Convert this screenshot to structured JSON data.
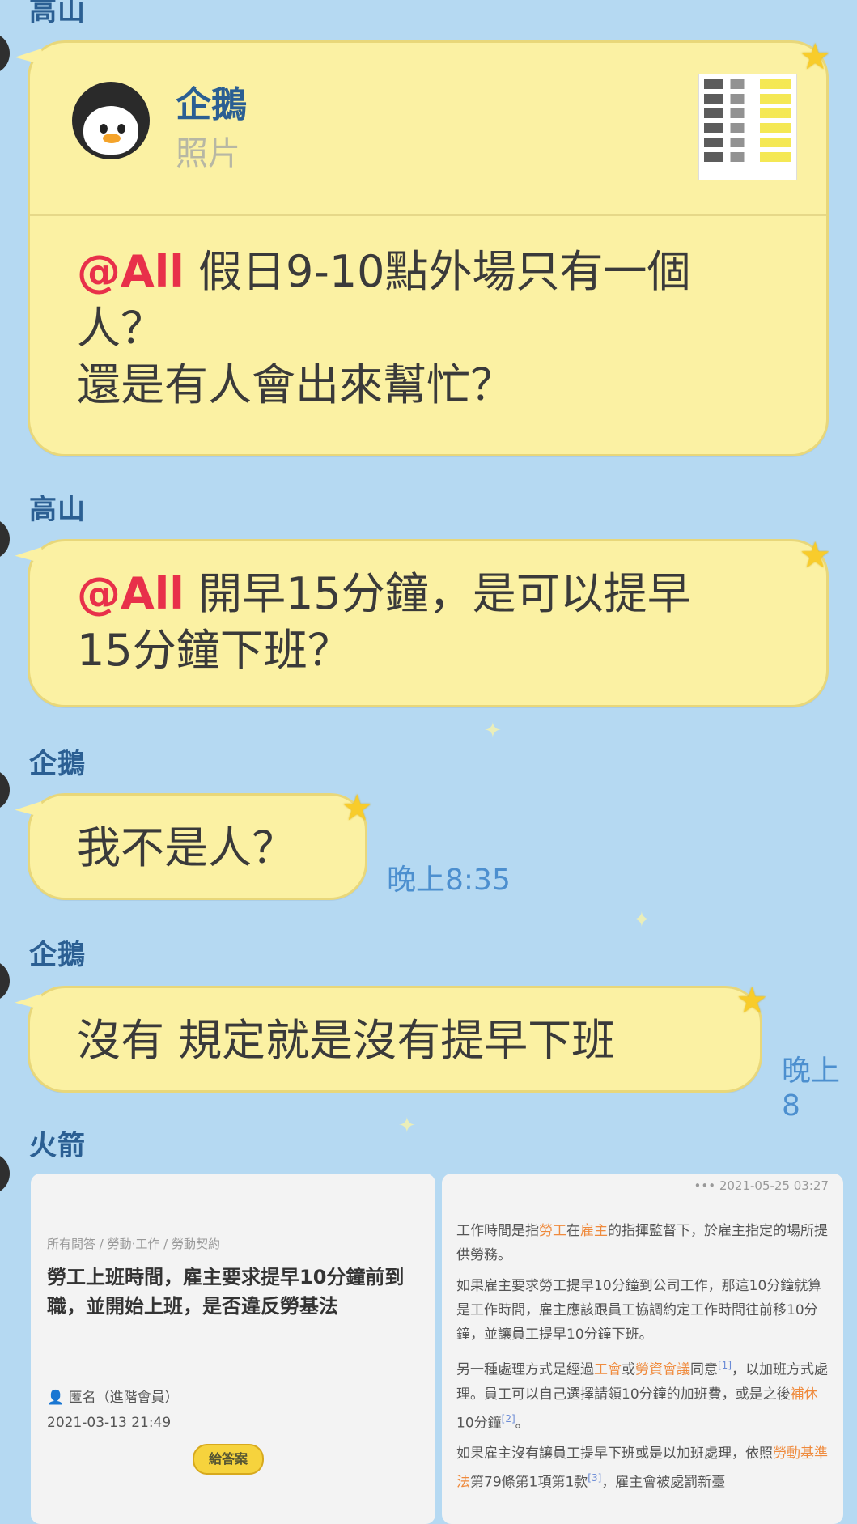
{
  "messages": [
    {
      "sender": "高山"
    },
    {
      "reply": {
        "name": "企鵝",
        "type": "照片"
      },
      "mention": "@All",
      "text_lines": [
        "假日9-10點外場只有一個",
        "人？",
        "還是有人會出來幫忙？"
      ]
    },
    {
      "sender": "高山",
      "mention": "@All",
      "text_lines": [
        "開早15分鐘，是可以提早",
        "15分鐘下班？"
      ]
    },
    {
      "sender": "企鵝",
      "text": "我不是人？",
      "time": "晚上8:35"
    },
    {
      "sender": "企鵝",
      "text": "沒有 規定就是沒有提早下班",
      "time": "晚上8"
    },
    {
      "sender": "火箭"
    }
  ],
  "article": {
    "breadcrumb": "所有問答 / 勞動·工作 / 勞動契約",
    "title": "勞工上班時間，雇主要求提早10分鐘前到職，並開始上班，是否違反勞基法",
    "author": "匿名（進階會員）",
    "date": "2021-03-13 21:49",
    "answer_button": "給答案"
  },
  "answer": {
    "timestamp": "••• 2021-05-25 03:27",
    "p1_a": "工作時間是指",
    "p1_b": "勞工",
    "p1_c": "在",
    "p1_d": "雇主",
    "p1_e": "的指揮監督下，於雇主指定的場所提供勞務。",
    "p2": "如果雇主要求勞工提早10分鐘到公司工作，那這10分鐘就算是工作時間，雇主應該跟員工協調約定工作時間往前移10分鐘，並讓員工提早10分鐘下班。",
    "p3_a": "另一種處理方式是經過",
    "p3_b": "工會",
    "p3_c": "或",
    "p3_d": "勞資會議",
    "p3_e": "同意",
    "p3_ref": "[1]",
    "p3_f": "，以加班方式處理。員工可以自己選擇請領10分鐘的加班費，或是之後",
    "p3_g": "補休",
    "p3_h": "10分鐘",
    "p3_ref2": "[2]",
    "p3_i": "。",
    "p4_a": "如果雇主沒有讓員工提早下班或是以加班處理，依照",
    "p4_b": "勞動基準法",
    "p4_c": "第79條第1項第1款",
    "p4_ref": "[3]",
    "p4_d": "，雇主會被處罰新臺"
  },
  "colors": {
    "bubble": "#fbf1a3",
    "sender": "#2b5f93",
    "mention": "#e8304a",
    "time": "#4c8fcf",
    "background": "#b5d9f2"
  }
}
